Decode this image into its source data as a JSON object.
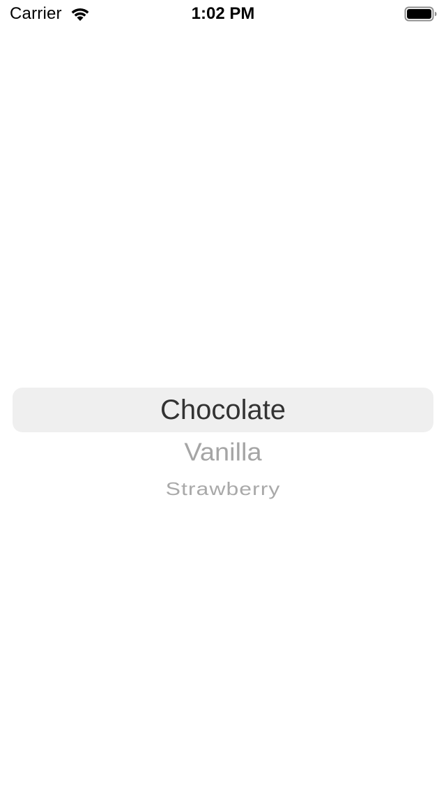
{
  "status_bar": {
    "carrier": "Carrier",
    "time": "1:02 PM",
    "wifi_icon": "wifi-icon",
    "battery_icon": "battery-full-icon"
  },
  "picker": {
    "selected": "Chocolate",
    "options": [
      "Chocolate",
      "Vanilla",
      "Strawberry"
    ],
    "highlight_color": "#efefef",
    "selected_text_color": "#333333",
    "unselected_text_color": "#a5a5a5"
  }
}
